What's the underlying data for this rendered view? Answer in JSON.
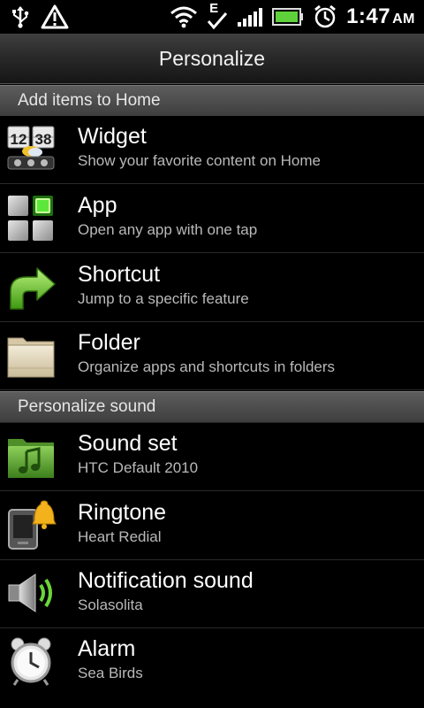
{
  "status_bar": {
    "time": "1:47",
    "ampm": "AM",
    "network": "E",
    "icons": [
      "usb-icon",
      "warning-icon",
      "wifi-icon",
      "signal-icon",
      "battery-icon",
      "alarm-clock-icon"
    ],
    "battery_color": "#5fd13a"
  },
  "header": {
    "title": "Personalize"
  },
  "sections": [
    {
      "title": "Add items to Home",
      "items": [
        {
          "title": "Widget",
          "subtitle": "Show your favorite content on Home",
          "icon": "widget-icon"
        },
        {
          "title": "App",
          "subtitle": "Open any app with one tap",
          "icon": "app-grid-icon"
        },
        {
          "title": "Shortcut",
          "subtitle": "Jump to a specific feature",
          "icon": "shortcut-arrow-icon"
        },
        {
          "title": "Folder",
          "subtitle": "Organize apps and shortcuts in folders",
          "icon": "folder-icon"
        }
      ]
    },
    {
      "title": "Personalize sound",
      "items": [
        {
          "title": "Sound set",
          "subtitle": "HTC Default 2010",
          "icon": "music-folder-icon"
        },
        {
          "title": "Ringtone",
          "subtitle": "Heart Redial",
          "icon": "ringtone-bell-icon"
        },
        {
          "title": "Notification sound",
          "subtitle": "Solasolita",
          "icon": "speaker-icon"
        },
        {
          "title": "Alarm",
          "subtitle": "Sea Birds",
          "icon": "alarm-clock-icon"
        }
      ]
    }
  ],
  "widget_icon_digits": [
    "12",
    "38"
  ]
}
